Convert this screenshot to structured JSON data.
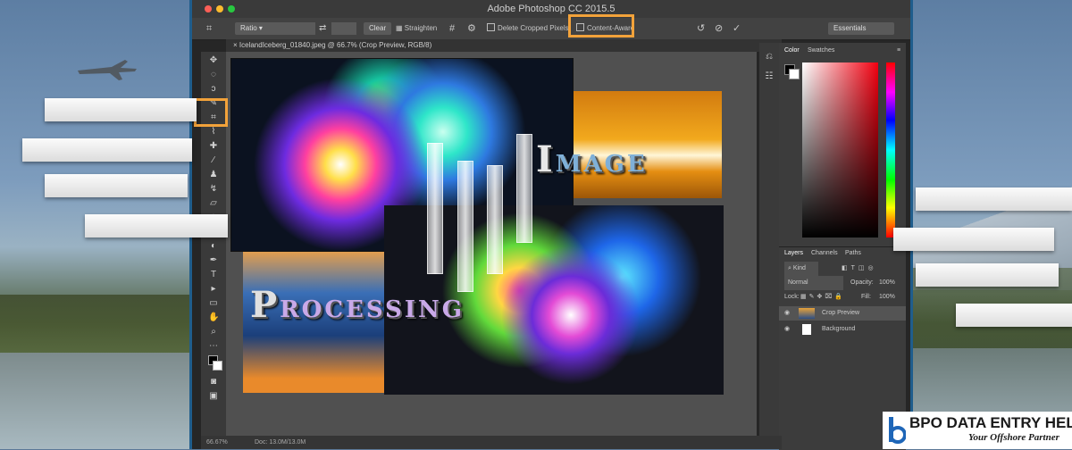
{
  "window": {
    "title": "Adobe Photoshop CC 2015.5"
  },
  "options_bar": {
    "ratio_select": "Ratio",
    "clear_button": "Clear",
    "straighten_label": "Straighten",
    "delete_cropped_label": "Delete Cropped Pixels",
    "content_aware_label": "Content-Aware",
    "workspace_select": "Essentials"
  },
  "document": {
    "tab_label": "IcelandIceberg_01840.jpeg @ 66.7% (Crop Preview, RGB/8)"
  },
  "status": {
    "zoom": "66.67%",
    "doc_size": "Doc: 13.0M/13.0M"
  },
  "color_panel": {
    "tabs": [
      "Color",
      "Swatches"
    ]
  },
  "layers_panel": {
    "tabs": [
      "Layers",
      "Channels",
      "Paths"
    ],
    "kind_filter": "Kind",
    "blend_mode": "Normal",
    "opacity_label": "Opacity:",
    "opacity_value": "100%",
    "lock_label": "Lock:",
    "fill_label": "Fill:",
    "fill_value": "100%",
    "layers": [
      {
        "name": "Crop Preview"
      },
      {
        "name": "Background"
      }
    ]
  },
  "overlay_text": {
    "image_cap": "I",
    "image_rest": "MAGE",
    "processing_cap": "P",
    "processing_rest": "ROCESSING"
  },
  "logo": {
    "name": "BPO DATA ENTRY HELP",
    "tagline": "Your Offshore Partner"
  },
  "colors": {
    "accent_highlight": "#f2a23a",
    "window_border": "#1f5d8c"
  }
}
